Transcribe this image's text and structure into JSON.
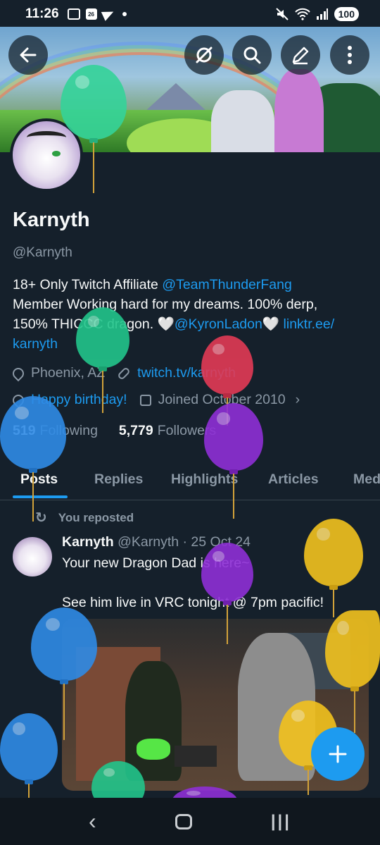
{
  "status_bar": {
    "time": "11:26",
    "calendar_day": "26",
    "battery": "100"
  },
  "profile": {
    "name": "Karnyth",
    "handle": "@Karnyth",
    "bio": {
      "line1_text": "18+ Only  Twitch Affiliate ",
      "line1_link": "@TeamThunderFang",
      "line2_text": "Member  Working hard for my dreams. 100% derp,",
      "line3_text": "150% THICCC dragon. 🤍",
      "line3_link1": "@KyronLadon",
      "line3_heart": "🤍 ",
      "line3_link2": "linktr.ee/",
      "line4_link": "karnyth"
    },
    "location": "Phoenix, AZ",
    "website": "twitch.tv/karnyth",
    "birthday": "Happy birthday!",
    "joined": "Joined October 2010",
    "following_count": "519",
    "following_label": "Following",
    "followers_count": "5,779",
    "followers_label": "Followers"
  },
  "tabs": [
    "Posts",
    "Replies",
    "Highlights",
    "Articles",
    "Media"
  ],
  "post": {
    "repost_label": "You reposted",
    "author_name": "Karnyth",
    "author_meta": "@Karnyth · 25 Oct 24",
    "line1": "Your new Dragon Dad is here~",
    "line2": "See him live in VRC tonight @ 7pm pacific!"
  },
  "icons": {
    "back": "arrow-left-icon",
    "hide": "eye-slash-icon",
    "search": "search-icon",
    "edit": "pencil-icon",
    "more": "more-vertical-icon",
    "compose": "plus-icon"
  },
  "colors": {
    "background": "#15202b",
    "accent": "#1d9bf0",
    "secondary_text": "#8b98a5"
  }
}
